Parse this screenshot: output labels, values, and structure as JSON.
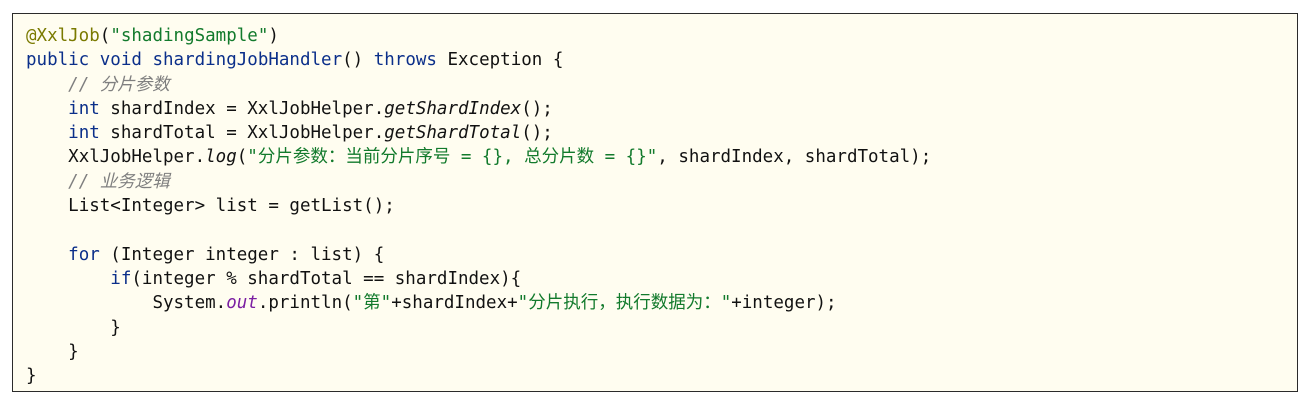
{
  "code": {
    "lines": [
      {
        "indent": "",
        "tokens": [
          {
            "t": "@XxlJob",
            "c": "ann"
          },
          {
            "t": "(",
            "c": "plain"
          },
          {
            "t": "\"shadingSample\"",
            "c": "str"
          },
          {
            "t": ")",
            "c": "plain"
          }
        ]
      },
      {
        "indent": "",
        "tokens": [
          {
            "t": "public",
            "c": "kw"
          },
          {
            "t": " ",
            "c": "plain"
          },
          {
            "t": "void",
            "c": "kw"
          },
          {
            "t": " ",
            "c": "plain"
          },
          {
            "t": "shardingJobHandler",
            "c": "kw"
          },
          {
            "t": "() ",
            "c": "plain"
          },
          {
            "t": "throws",
            "c": "kw"
          },
          {
            "t": " Exception {",
            "c": "plain"
          }
        ]
      },
      {
        "indent": "    ",
        "tokens": [
          {
            "t": "// 分片参数",
            "c": "cm"
          }
        ]
      },
      {
        "indent": "    ",
        "tokens": [
          {
            "t": "int",
            "c": "kw"
          },
          {
            "t": " shardIndex = XxlJobHelper.",
            "c": "plain"
          },
          {
            "t": "getShardIndex",
            "c": "it"
          },
          {
            "t": "();",
            "c": "plain"
          }
        ]
      },
      {
        "indent": "    ",
        "tokens": [
          {
            "t": "int",
            "c": "kw"
          },
          {
            "t": " shardTotal = XxlJobHelper.",
            "c": "plain"
          },
          {
            "t": "getShardTotal",
            "c": "it"
          },
          {
            "t": "();",
            "c": "plain"
          }
        ]
      },
      {
        "indent": "    ",
        "tokens": [
          {
            "t": "XxlJobHelper.",
            "c": "plain"
          },
          {
            "t": "log",
            "c": "it"
          },
          {
            "t": "(",
            "c": "plain"
          },
          {
            "t": "\"分片参数：当前分片序号 = {}, 总分片数 = {}\"",
            "c": "str"
          },
          {
            "t": ", shardIndex, shardTotal);",
            "c": "plain"
          }
        ]
      },
      {
        "indent": "    ",
        "tokens": [
          {
            "t": "// 业务逻辑",
            "c": "cm"
          }
        ]
      },
      {
        "indent": "    ",
        "tokens": [
          {
            "t": "List<Integer> list = getList();",
            "c": "plain"
          }
        ]
      },
      {
        "indent": "",
        "tokens": []
      },
      {
        "indent": "    ",
        "tokens": [
          {
            "t": "for",
            "c": "kw"
          },
          {
            "t": " (Integer integer : list) {",
            "c": "plain"
          }
        ]
      },
      {
        "indent": "        ",
        "tokens": [
          {
            "t": "if",
            "c": "kw"
          },
          {
            "t": "(integer % shardTotal == shardIndex){",
            "c": "plain"
          }
        ]
      },
      {
        "indent": "            ",
        "tokens": [
          {
            "t": "System.",
            "c": "plain"
          },
          {
            "t": "out",
            "c": "field"
          },
          {
            "t": ".println(",
            "c": "plain"
          },
          {
            "t": "\"第\"",
            "c": "str"
          },
          {
            "t": "+shardIndex+",
            "c": "plain"
          },
          {
            "t": "\"分片执行，执行数据为：\"",
            "c": "str"
          },
          {
            "t": "+integer);",
            "c": "plain"
          }
        ]
      },
      {
        "indent": "        ",
        "tokens": [
          {
            "t": "}",
            "c": "plain"
          }
        ]
      },
      {
        "indent": "    ",
        "tokens": [
          {
            "t": "}",
            "c": "plain"
          }
        ]
      },
      {
        "indent": "",
        "tokens": [
          {
            "t": "}",
            "c": "plain"
          }
        ]
      }
    ]
  },
  "colors": {
    "background": "#fffdf0",
    "border": "#2b2b2b",
    "keyword": "#0b2f8a",
    "string": "#127a2c",
    "annotation": "#7a7a00",
    "comment": "#7f7f7f",
    "field": "#7b1fa2"
  }
}
